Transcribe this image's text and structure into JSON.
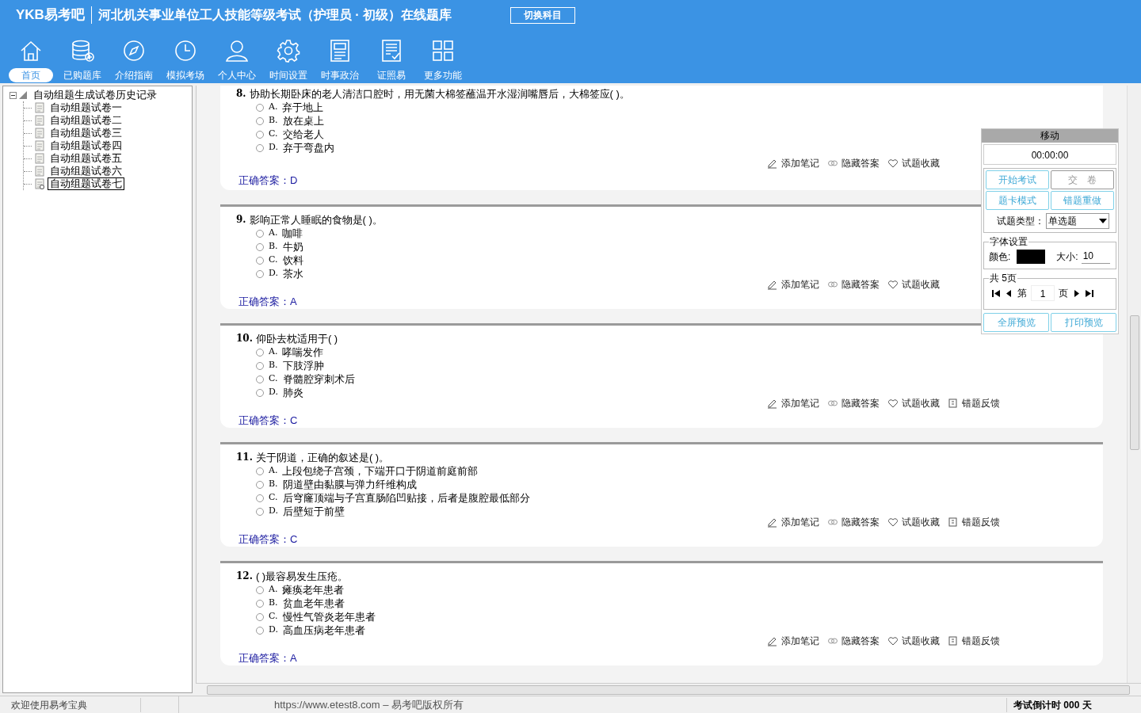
{
  "header": {
    "logo": "YKB易考吧",
    "title": "河北机关事业单位工人技能等级考试（护理员 · 初级）在线题库",
    "switch_button": "切换科目"
  },
  "toolbar": [
    {
      "kind": "home",
      "label": "首页",
      "selected": true
    },
    {
      "kind": "database",
      "label": "已购题库",
      "selected": false
    },
    {
      "kind": "compass",
      "label": "介绍指南",
      "selected": false
    },
    {
      "kind": "clock",
      "label": "模拟考场",
      "selected": false
    },
    {
      "kind": "user",
      "label": "个人中心",
      "selected": false
    },
    {
      "kind": "gear",
      "label": "时间设置",
      "selected": false
    },
    {
      "kind": "news",
      "label": "时事政治",
      "selected": false
    },
    {
      "kind": "checklist",
      "label": "证照易",
      "selected": false
    },
    {
      "kind": "grid",
      "label": "更多功能",
      "selected": false
    }
  ],
  "tree": {
    "label": "自动组题生成试卷历史记录",
    "expanded": true,
    "children": [
      {
        "label": "自动组题试卷一",
        "selected": false
      },
      {
        "label": "自动组题试卷二",
        "selected": false
      },
      {
        "label": "自动组题试卷三",
        "selected": false
      },
      {
        "label": "自动组题试卷四",
        "selected": false
      },
      {
        "label": "自动组题试卷五",
        "selected": false
      },
      {
        "label": "自动组题试卷六",
        "selected": false
      },
      {
        "label": "自动组题试卷七",
        "selected": true
      }
    ]
  },
  "questions": [
    {
      "number": "8.",
      "text": "协助长期卧床的老人清洁口腔时，用无菌大棉签蘸温开水湿润嘴唇后，大棉签应( )。",
      "options": [
        {
          "letter": "A.",
          "text": "弃于地上",
          "checked": false
        },
        {
          "letter": "B.",
          "text": "放在桌上",
          "checked": false
        },
        {
          "letter": "C.",
          "text": "交给老人",
          "checked": false
        },
        {
          "letter": "D.",
          "text": "弃于弯盘内",
          "checked": false
        }
      ],
      "actions": [
        {
          "kind": "note",
          "label": "添加笔记"
        },
        {
          "kind": "hide",
          "label": "隐藏答案"
        },
        {
          "kind": "fav",
          "label": "试题收藏"
        }
      ],
      "answer": "正确答案：D"
    },
    {
      "number": "9.",
      "text": "影响正常人睡眠的食物是( )。",
      "options": [
        {
          "letter": "A.",
          "text": "咖啡",
          "checked": false
        },
        {
          "letter": "B.",
          "text": "牛奶",
          "checked": false
        },
        {
          "letter": "C.",
          "text": "饮料",
          "checked": false
        },
        {
          "letter": "D.",
          "text": "茶水",
          "checked": false
        }
      ],
      "actions": [
        {
          "kind": "note",
          "label": "添加笔记"
        },
        {
          "kind": "hide",
          "label": "隐藏答案"
        },
        {
          "kind": "fav",
          "label": "试题收藏"
        }
      ],
      "answer": "正确答案：A"
    },
    {
      "number": "10.",
      "text": "仰卧去枕适用于( )",
      "options": [
        {
          "letter": "A.",
          "text": "哮喘发作",
          "checked": false
        },
        {
          "letter": "B.",
          "text": "下肢浮肿",
          "checked": false
        },
        {
          "letter": "C.",
          "text": "脊髓腔穿刺术后",
          "checked": false
        },
        {
          "letter": "D.",
          "text": "肺炎",
          "checked": false
        }
      ],
      "actions": [
        {
          "kind": "note",
          "label": "添加笔记"
        },
        {
          "kind": "hide",
          "label": "隐藏答案"
        },
        {
          "kind": "fav",
          "label": "试题收藏"
        },
        {
          "kind": "report",
          "label": "错题反馈"
        }
      ],
      "answer": "正确答案：C"
    },
    {
      "number": "11.",
      "text": "关于阴道，正确的叙述是( )。",
      "options": [
        {
          "letter": "A.",
          "text": "上段包绕子宫颈，下端开口于阴道前庭前部",
          "checked": false
        },
        {
          "letter": "B.",
          "text": "阴道壁由黏膜与弹力纤维构成",
          "checked": false
        },
        {
          "letter": "C.",
          "text": "后穹窿顶端与子宫直肠陷凹贴接，后者是腹腔最低部分",
          "checked": false
        },
        {
          "letter": "D.",
          "text": "后壁短于前壁",
          "checked": false
        }
      ],
      "actions": [
        {
          "kind": "note",
          "label": "添加笔记"
        },
        {
          "kind": "hide",
          "label": "隐藏答案"
        },
        {
          "kind": "fav",
          "label": "试题收藏"
        },
        {
          "kind": "report",
          "label": "错题反馈"
        }
      ],
      "answer": "正确答案：C"
    },
    {
      "number": "12.",
      "text": "( )最容易发生压疮。",
      "options": [
        {
          "letter": "A.",
          "text": "瘫痪老年患者",
          "checked": false
        },
        {
          "letter": "B.",
          "text": "贫血老年患者",
          "checked": false
        },
        {
          "letter": "C.",
          "text": "慢性气管炎老年患者",
          "checked": false
        },
        {
          "letter": "D.",
          "text": "高血压病老年患者",
          "checked": false
        }
      ],
      "actions": [
        {
          "kind": "note",
          "label": "添加笔记"
        },
        {
          "kind": "hide",
          "label": "隐藏答案"
        },
        {
          "kind": "fav",
          "label": "试题收藏"
        },
        {
          "kind": "report",
          "label": "错题反馈"
        }
      ],
      "answer": "正确答案：A"
    }
  ],
  "panel": {
    "title": "移动",
    "timer": "00:00:00",
    "buttons": [
      {
        "label": "开始考试",
        "disabled": false
      },
      {
        "label": "交　卷",
        "disabled": true
      },
      {
        "label": "题卡模式",
        "disabled": false
      },
      {
        "label": "错题重做",
        "disabled": false
      }
    ],
    "type_label": "试题类型：",
    "type_value": "单选题",
    "font_legend": "字体设置",
    "color_label": "颜色:",
    "color": "#000000",
    "size_label": "大小:",
    "size_value": "10",
    "pages_legend": "共 5页",
    "page_prefix": "第",
    "page_value": "1",
    "page_suffix": "页",
    "preview_buttons": [
      "全屏预览",
      "打印预览"
    ]
  },
  "status": {
    "welcome": "欢迎使用易考宝典",
    "copyright": "https://www.etest8.com – 易考吧版权所有",
    "countdown": "考试倒计时 000 天"
  }
}
